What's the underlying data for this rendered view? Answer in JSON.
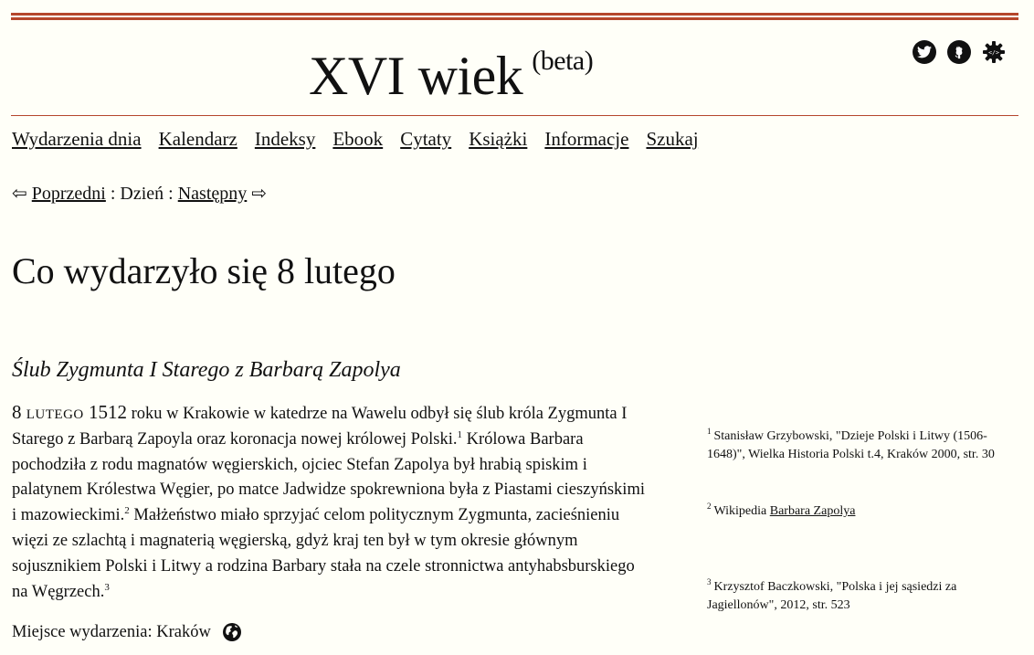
{
  "header": {
    "site_title": "XVI wiek",
    "site_badge": "(beta)"
  },
  "icons": [
    "twitter-icon",
    "github-icon",
    "gear-icon",
    "globe-icon"
  ],
  "nav": {
    "items": [
      {
        "label": "Wydarzenia dnia"
      },
      {
        "label": "Kalendarz"
      },
      {
        "label": "Indeksy"
      },
      {
        "label": "Ebook"
      },
      {
        "label": "Cytaty"
      },
      {
        "label": "Książki"
      },
      {
        "label": "Informacje"
      },
      {
        "label": "Szukaj"
      }
    ]
  },
  "day_nav": {
    "prev_arrow": "⇦",
    "prev_label": "Poprzedni",
    "middle": " : Dzień : ",
    "next_label": "Następny",
    "next_arrow": "⇨"
  },
  "page": {
    "heading": "Co wydarzyło się 8 lutego"
  },
  "event": {
    "title": "Ślub Zygmunta I Starego z Barbarą Zapolya",
    "day": "8",
    "month": "lutego",
    "year": "1512",
    "text_part1": " roku w Krakowie w katedrze na Wawelu odbył się ślub króla Zygmunta I Starego z Barbarą Zapoyla oraz koronacja nowej królowej Polski.",
    "ref1": "1",
    "text_part2": " Królowa Barbara pochodziła z rodu magnatów węgierskich, ojciec Stefan Zapolya był hrabią spiskim i palatynem Królestwa Węgier, po matce Jadwidze spokrewniona była z Piastami cieszyńskimi i mazowieckimi.",
    "ref2": "2",
    "text_part3": " Małżeństwo miało sprzyjać celom politycznym Zygmunta, zacieśnieniu więzi ze szlachtą i magnaterią węgierską, gdyż kraj ten był w tym okresie głównym sojusznikiem Polski i Litwy a rodzina Barbary stała na czele stronnictwa antyhabsburskiego na Węgrzech.",
    "ref3": "3",
    "place_label": "Miejsce wydarzenia: Kraków"
  },
  "footnotes": [
    {
      "num": "1",
      "text": "Stanisław Grzybowski, \"Dzieje Polski i Litwy (1506-1648)\", Wielka Historia Polski t.4, Kraków 2000, str. 30"
    },
    {
      "num": "2",
      "text": "Wikipedia ",
      "link": "Barbara Zapolya"
    },
    {
      "num": "3",
      "text": "Krzysztof Baczkowski, \"Polska i jej sąsiedzi za Jagiellonów\", 2012, str. 523"
    }
  ],
  "colors": {
    "accent": "#b5462c",
    "background": "#fffff8",
    "text": "#111111"
  }
}
